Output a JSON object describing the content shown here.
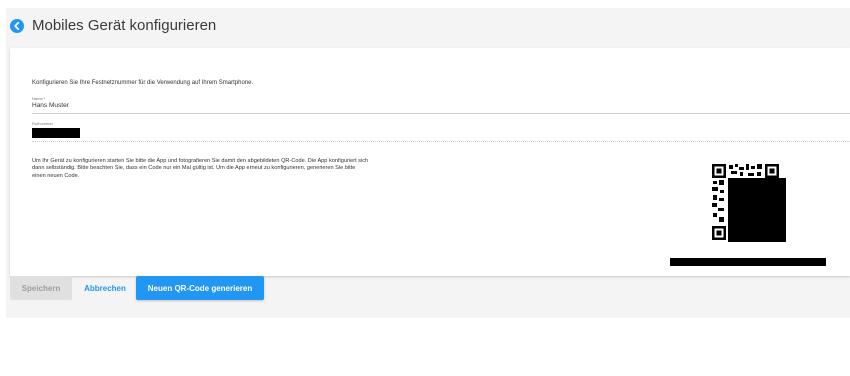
{
  "header": {
    "title": "Mobiles Gerät konfigurieren",
    "back_icon": "chevron-left-circle-icon",
    "accent_color": "#2196f3"
  },
  "form": {
    "intro": "Konfigurieren Sie Ihre Festnetznummer für die Verwendung auf Ihrem Smartphone.",
    "name_label": "Name *",
    "name_value": "Hans Muster",
    "phone_label": "Rufnummer",
    "phone_value_redacted": true
  },
  "info": {
    "lines": [
      "Um Ihr Gerät zu konfigurieren starten Sie bitte die App und fotografieren Sie damit den abgebildeten QR-Code. Die App konfiguriert sich",
      "dann selbständig. Bitte beachten Sie, dass ein Code nur ein Mal gültig ist. Um die App erneut zu konfigurieren, generieren Sie bitte",
      "einen neuen Code."
    ]
  },
  "qr": {
    "icon": "qr-code-icon",
    "partially_redacted": true
  },
  "actions": {
    "save_label": "Speichern",
    "cancel_label": "Abbrechen",
    "generate_label": "Neuen QR-Code generieren"
  }
}
